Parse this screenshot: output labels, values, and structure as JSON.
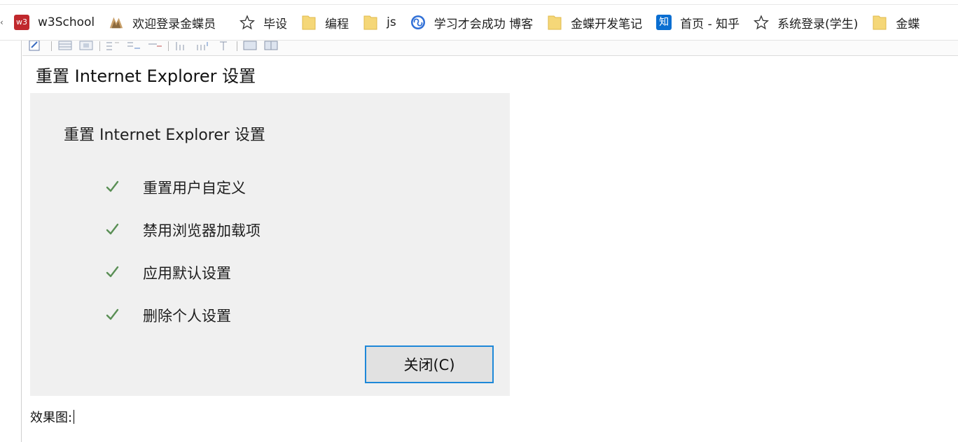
{
  "bookmarks": {
    "items": [
      {
        "label": "w3School",
        "icon": "w3school-icon"
      },
      {
        "label": "欢迎登录金蝶员",
        "icon": "kingdee-icon"
      },
      {
        "label": "毕设",
        "icon": "star-icon"
      },
      {
        "label": "编程",
        "icon": "folder-icon"
      },
      {
        "label": "js",
        "icon": "folder-icon"
      },
      {
        "label": "学习才会成功 博客",
        "icon": "blog-icon"
      },
      {
        "label": "金蝶开发笔记",
        "icon": "folder-icon"
      },
      {
        "label": "首页 - 知乎",
        "icon": "zhihu-icon"
      },
      {
        "label": "系统登录(学生)",
        "icon": "star-icon"
      },
      {
        "label": "金蝶",
        "icon": "folder-icon"
      }
    ],
    "w3_icon_text": "w3",
    "zhihu_icon_text": "知"
  },
  "page": {
    "heading": "重置 Internet Explorer 设置"
  },
  "panel": {
    "title": "重置 Internet Explorer 设置",
    "items": [
      "重置用户自定义",
      "禁用浏览器加载项",
      "应用默认设置",
      "删除个人设置"
    ],
    "close_label": "关闭(C)"
  },
  "caption": "效果图:",
  "colors": {
    "panel_bg": "#f0f0f0",
    "button_border": "#1e88d8",
    "check": "#5a8f55",
    "folder": "#f5d778",
    "w3_red": "#c0282d",
    "zhihu_blue": "#0a6ed1"
  }
}
